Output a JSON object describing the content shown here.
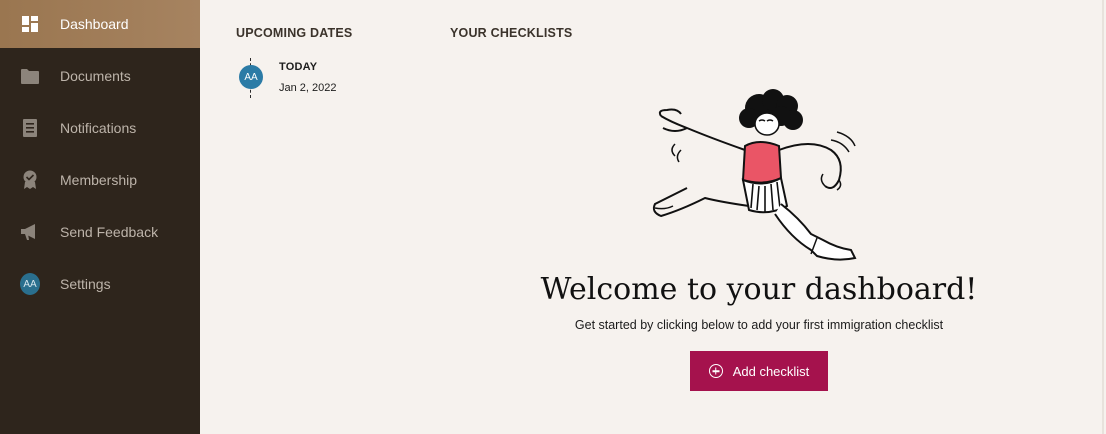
{
  "sidebar": {
    "items": [
      {
        "label": "Dashboard",
        "icon": "dashboard-grid-icon",
        "active": true
      },
      {
        "label": "Documents",
        "icon": "folder-icon"
      },
      {
        "label": "Notifications",
        "icon": "notifications-icon"
      },
      {
        "label": "Membership",
        "icon": "membership-badge-icon"
      },
      {
        "label": "Send Feedback",
        "icon": "megaphone-icon"
      },
      {
        "label": "Settings",
        "icon": "avatar-initials",
        "avatar_text": "AA"
      }
    ]
  },
  "upcoming": {
    "title": "UPCOMING DATES",
    "items": [
      {
        "avatar": "AA",
        "label": "TODAY",
        "date": "Jan 2, 2022"
      }
    ]
  },
  "checklists": {
    "title": "YOUR CHECKLISTS",
    "welcome_title": "Welcome to your dashboard!",
    "welcome_subtitle": "Get started by clicking below to add your first immigration checklist",
    "add_button_label": "Add checklist"
  },
  "colors": {
    "sidebar_bg": "#2e251c",
    "active_item": "#a08060",
    "accent_button": "#a5124d",
    "avatar": "#2b7ba6",
    "page_bg": "#f6f2ee"
  }
}
